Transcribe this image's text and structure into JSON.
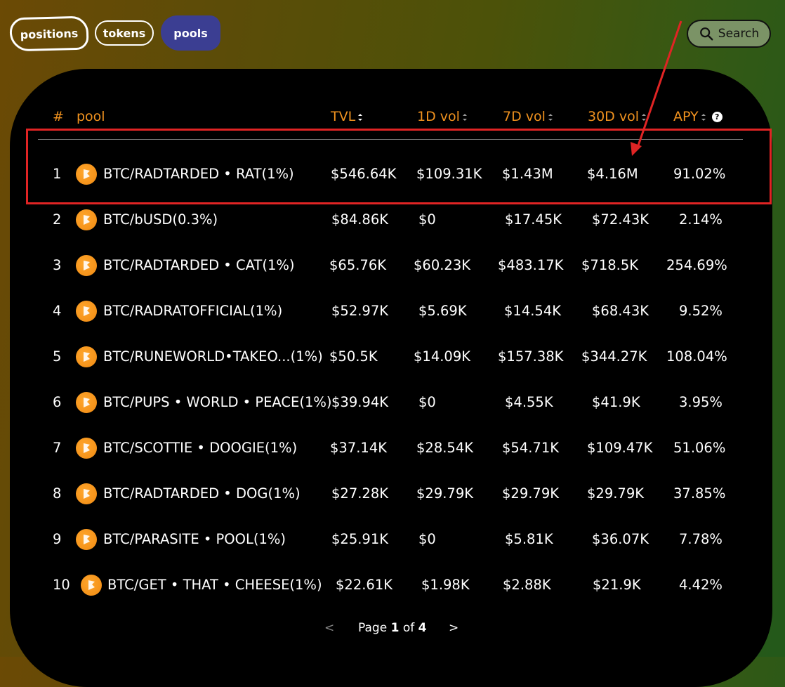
{
  "tabs": [
    {
      "label": "positions"
    },
    {
      "label": "tokens"
    },
    {
      "label": "pools"
    }
  ],
  "search": {
    "label": "Search",
    "icon": "search-icon"
  },
  "table": {
    "headers": {
      "rank": "#",
      "pool": "pool",
      "tvl": "TVL",
      "vol1d": "1D vol",
      "vol7d": "7D vol",
      "vol30d": "30D vol",
      "apy": "APY"
    },
    "rows": [
      {
        "rank": "1",
        "pool": "BTC/RADTARDED • RAT(1%)",
        "tvl": "$546.64K",
        "vol1d": "$109.31K",
        "vol7d": "$1.43M",
        "vol30d": "$4.16M",
        "apy": "91.02%"
      },
      {
        "rank": "2",
        "pool": "BTC/bUSD(0.3%)",
        "tvl": "$84.86K",
        "vol1d": "$0",
        "vol7d": "$17.45K",
        "vol30d": "$72.43K",
        "apy": "2.14%"
      },
      {
        "rank": "3",
        "pool": "BTC/RADTARDED • CAT(1%)",
        "tvl": "$65.76K",
        "vol1d": "$60.23K",
        "vol7d": "$483.17K",
        "vol30d": "$718.5K",
        "apy": "254.69%"
      },
      {
        "rank": "4",
        "pool": "BTC/RADRATOFFICIAL(1%)",
        "tvl": "$52.97K",
        "vol1d": "$5.69K",
        "vol7d": "$14.54K",
        "vol30d": "$68.43K",
        "apy": "9.52%"
      },
      {
        "rank": "5",
        "pool": "BTC/RUNEWORLD•TAKEO...(1%)",
        "tvl": "$50.5K",
        "vol1d": "$14.09K",
        "vol7d": "$157.38K",
        "vol30d": "$344.27K",
        "apy": "108.04%"
      },
      {
        "rank": "6",
        "pool": "BTC/PUPS • WORLD • PEACE(1%)",
        "tvl": "$39.94K",
        "vol1d": "$0",
        "vol7d": "$4.55K",
        "vol30d": "$41.9K",
        "apy": "3.95%"
      },
      {
        "rank": "7",
        "pool": "BTC/SCOTTIE • DOOGIE(1%)",
        "tvl": "$37.14K",
        "vol1d": "$28.54K",
        "vol7d": "$54.71K",
        "vol30d": "$109.47K",
        "apy": "51.06%"
      },
      {
        "rank": "8",
        "pool": "BTC/RADTARDED • DOG(1%)",
        "tvl": "$27.28K",
        "vol1d": "$29.79K",
        "vol7d": "$29.79K",
        "vol30d": "$29.79K",
        "apy": "37.85%"
      },
      {
        "rank": "9",
        "pool": "BTC/PARASITE • POOL(1%)",
        "tvl": "$25.91K",
        "vol1d": "$0",
        "vol7d": "$5.81K",
        "vol30d": "$36.07K",
        "apy": "7.78%"
      },
      {
        "rank": "10",
        "pool": "BTC/GET • THAT • CHEESE(1%)",
        "tvl": "$22.61K",
        "vol1d": "$1.98K",
        "vol7d": "$2.88K",
        "vol30d": "$21.9K",
        "apy": "4.42%"
      }
    ]
  },
  "pagination": {
    "prev": "<",
    "page_word": "Page",
    "current": "1",
    "of_word": "of",
    "total": "4",
    "next": ">"
  },
  "colors": {
    "accent": "#f0921f",
    "highlight": "#e02424",
    "active_tab": "#3b3e92",
    "search_bg": "#7b9366"
  }
}
